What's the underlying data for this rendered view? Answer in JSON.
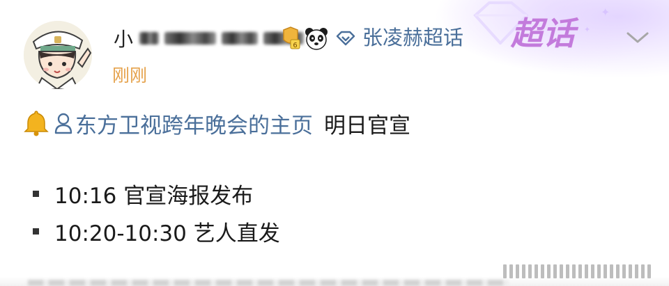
{
  "post": {
    "username": "小",
    "topic": {
      "icon": "diamond-outline-icon",
      "name": "张凌赫超话",
      "super_label": "超话"
    },
    "level_badge": "6",
    "timestamp": "刚刚",
    "mention": {
      "icon": "bell-icon",
      "person_icon": "person-icon",
      "text": "东方卫视跨年晚会的主页",
      "after": "明日官宣"
    },
    "bullets": [
      {
        "text": "10:16 官宣海报发布"
      },
      {
        "text": "10:20-10:30 艺人直发"
      }
    ]
  },
  "colors": {
    "link": "#4a6f9a",
    "timestamp": "#e5a14a",
    "super_label": "#c37bdc",
    "text": "#1a1a1a"
  }
}
